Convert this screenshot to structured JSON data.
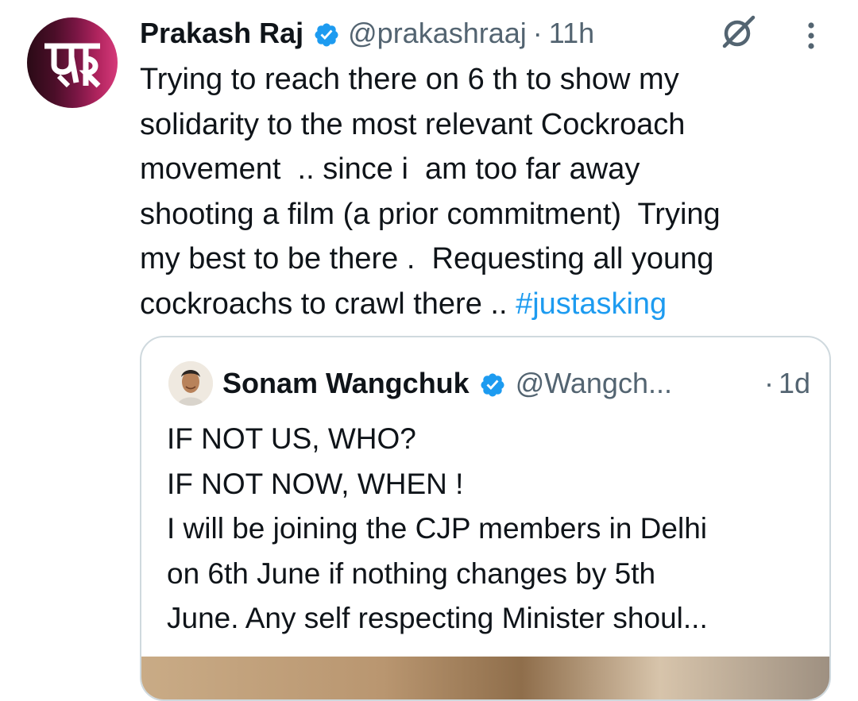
{
  "tweet": {
    "author_name": "Prakash Raj",
    "handle": "@prakashraaj",
    "separator": "·",
    "time": "11h",
    "text": "Trying to reach there on 6 th to show my\nsolidarity to the most relevant Cockroach\nmovement  .. since i  am too far away\nshooting a film (a prior commitment)  Trying\nmy best to be there .  Requesting all young\ncockroachs to crawl there .. ",
    "hashtag": "#justasking",
    "avatar_icon": "pr-monogram-logo",
    "verified_icon": "verified-badge-icon",
    "grok_icon": "grok-icon",
    "more_icon": "more-vertical-icon"
  },
  "quote": {
    "author_name": "Sonam Wangchuk",
    "handle": "@Wangch...",
    "separator": "·",
    "time": "1d",
    "text": "IF NOT US, WHO?\nIF NOT NOW, WHEN !\nI will be joining the CJP members in Delhi\non 6th June if nothing changes by 5th\nJune. Any self respecting Minister shoul..."
  },
  "colors": {
    "text": "#0f1419",
    "secondary": "#536471",
    "link": "#1d9bf0",
    "border": "#cfd9de",
    "verified": "#1d9bf0"
  }
}
